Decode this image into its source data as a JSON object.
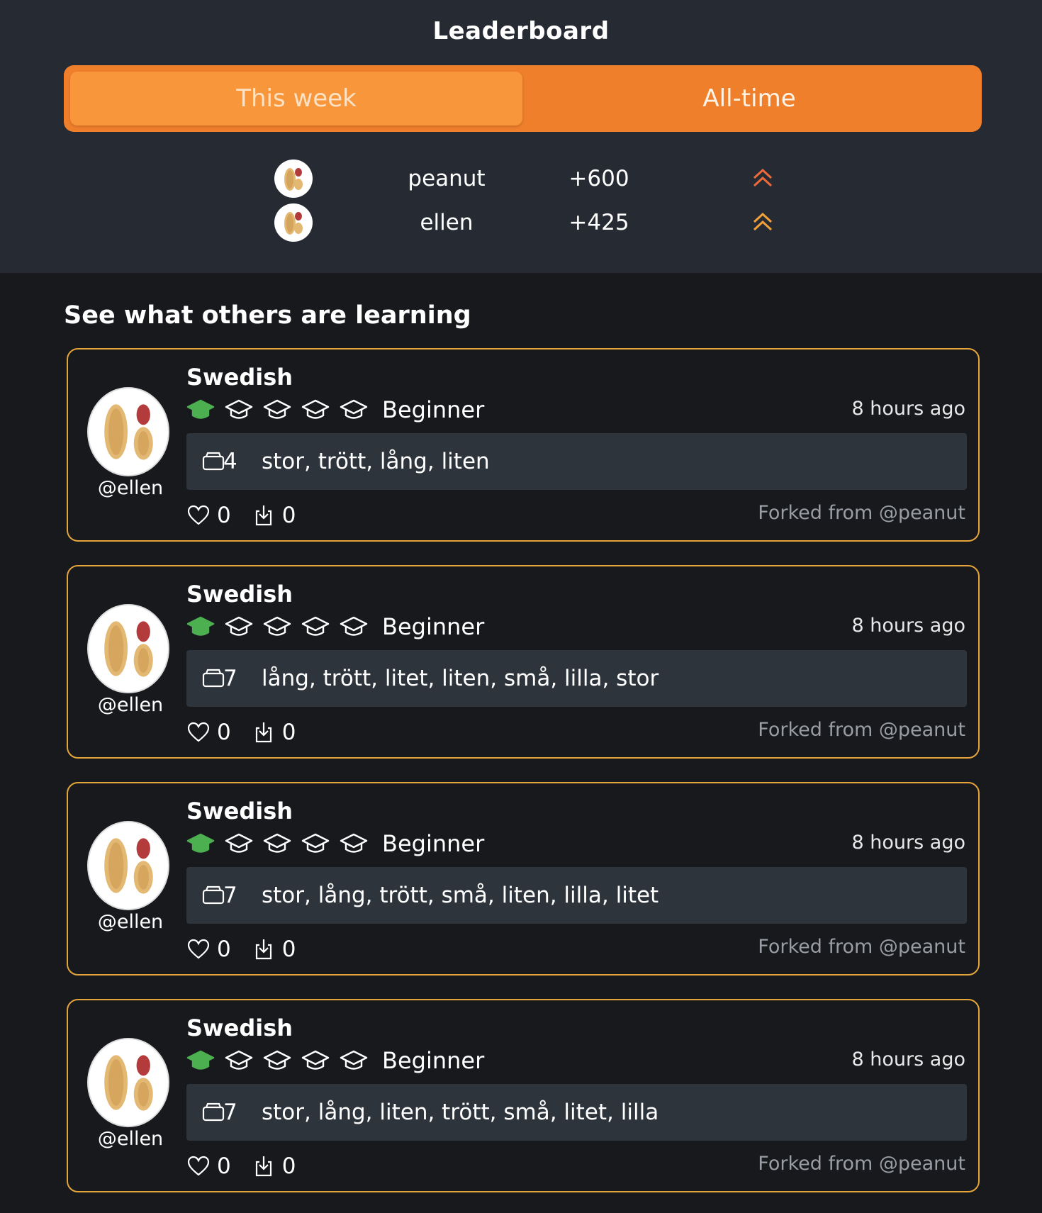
{
  "leaderboard": {
    "title": "Leaderboard",
    "tabs": {
      "this_week": "This week",
      "all_time": "All-time",
      "active": "This week"
    },
    "entries": [
      {
        "name": "peanut",
        "score": "+600",
        "trend_icon": "double-chevron-up-icon",
        "trend_color": "#ef6a3a"
      },
      {
        "name": "ellen",
        "score": "+425",
        "trend_icon": "double-chevron-up-icon",
        "trend_color": "#f3a23a"
      }
    ]
  },
  "feed": {
    "title": "See what others are learning",
    "cards": [
      {
        "user": "@ellen",
        "language": "Swedish",
        "level": "Beginner",
        "level_value": 1,
        "level_max": 5,
        "time": "8 hours ago",
        "deck_count": "4",
        "words": "stor, trött, lång, liten",
        "likes": "0",
        "downloads": "0",
        "fork": "Forked from @peanut"
      },
      {
        "user": "@ellen",
        "language": "Swedish",
        "level": "Beginner",
        "level_value": 1,
        "level_max": 5,
        "time": "8 hours ago",
        "deck_count": "7",
        "words": "lång, trött, litet, liten, små, lilla, stor",
        "likes": "0",
        "downloads": "0",
        "fork": "Forked from @peanut"
      },
      {
        "user": "@ellen",
        "language": "Swedish",
        "level": "Beginner",
        "level_value": 1,
        "level_max": 5,
        "time": "8 hours ago",
        "deck_count": "7",
        "words": "stor, lång, trött, små, liten, lilla, litet",
        "likes": "0",
        "downloads": "0",
        "fork": "Forked from @peanut"
      },
      {
        "user": "@ellen",
        "language": "Swedish",
        "level": "Beginner",
        "level_value": 1,
        "level_max": 5,
        "time": "8 hours ago",
        "deck_count": "7",
        "words": "stor, lång, liten, trött, små, litet, lilla",
        "likes": "0",
        "downloads": "0",
        "fork": "Forked from @peanut"
      }
    ]
  },
  "colors": {
    "accent": "#f07f2c",
    "card_border": "#e6a53b",
    "level_active": "#4caf50"
  }
}
